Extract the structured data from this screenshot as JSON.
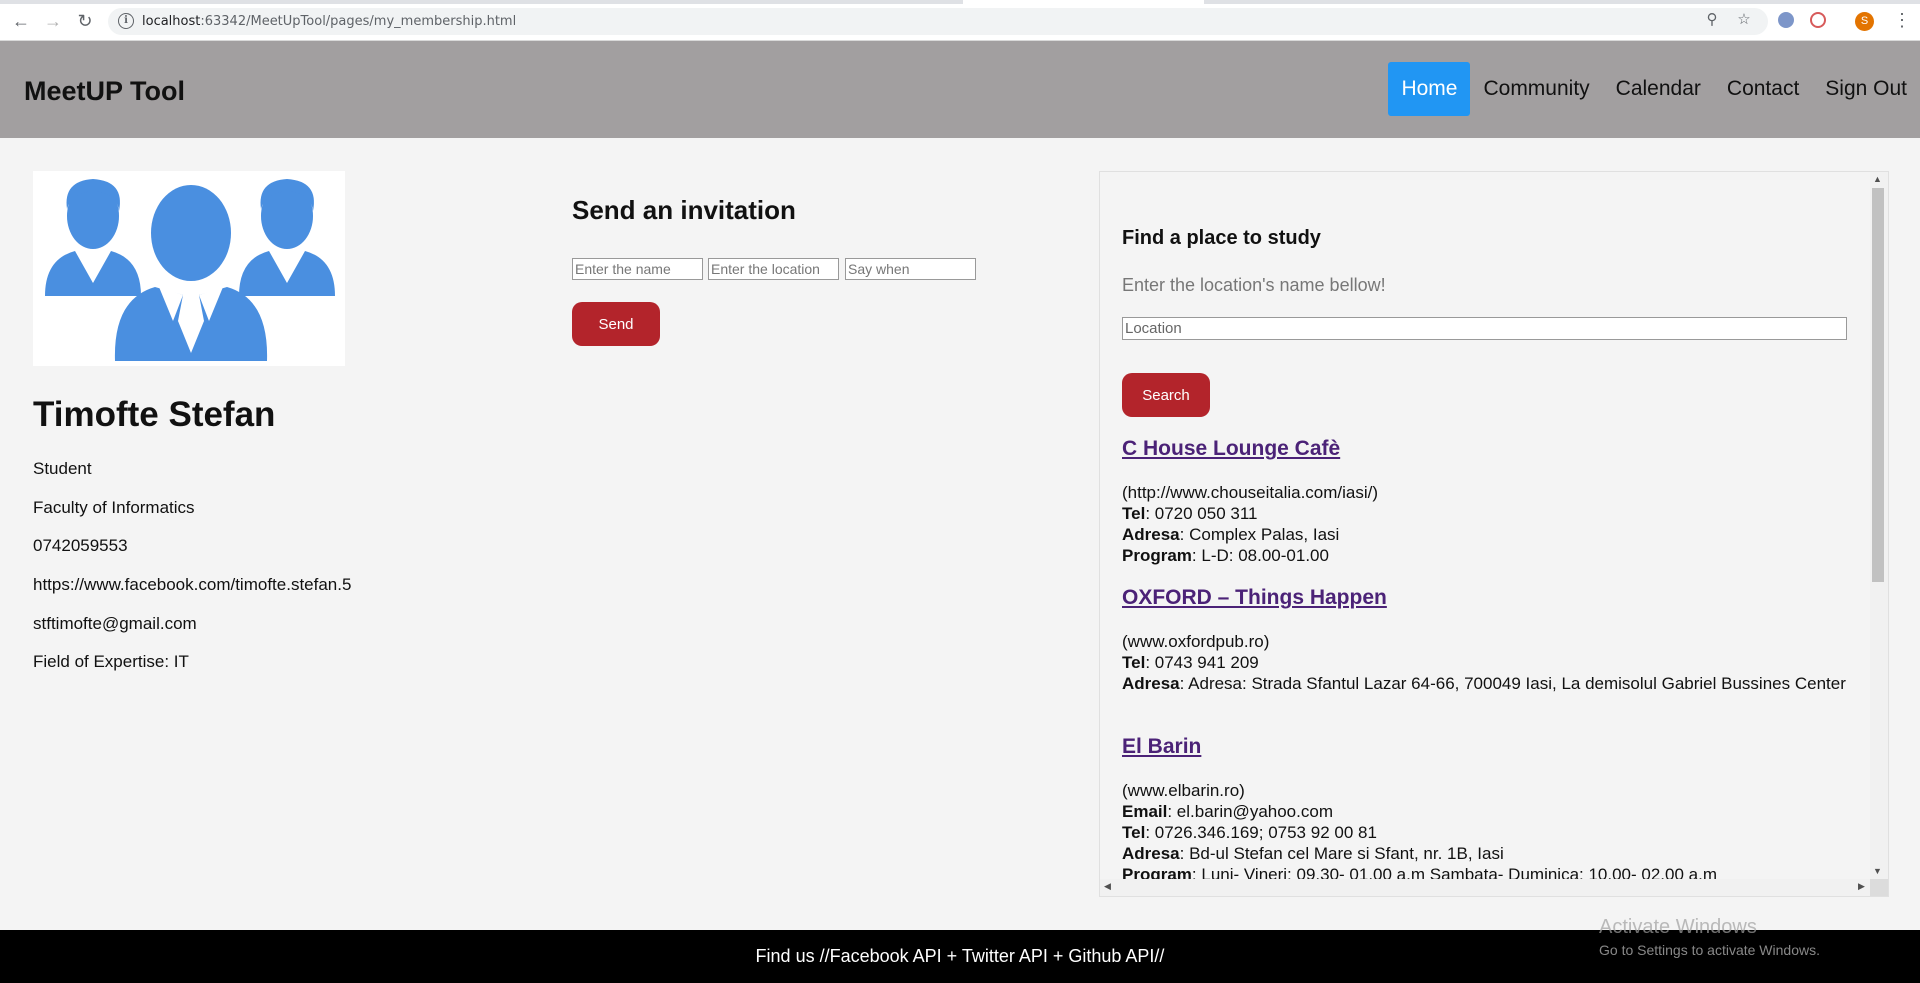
{
  "browser": {
    "url_host": "localhost",
    "url_rest": ":63342/MeetUpTool/pages/my_membership.html",
    "avatar_letter": "S"
  },
  "header": {
    "brand": "MeetUP Tool",
    "nav": [
      {
        "label": "Home",
        "active": true
      },
      {
        "label": "Community"
      },
      {
        "label": "Calendar"
      },
      {
        "label": "Contact"
      },
      {
        "label": "Sign Out"
      }
    ],
    "active_color": "#2196f3"
  },
  "profile": {
    "name": "Timofte Stefan",
    "role": "Student",
    "faculty": "Faculty of Informatics",
    "phone": "0742059553",
    "facebook": "https://www.facebook.com/timofte.stefan.5",
    "email": "stftimofte@gmail.com",
    "expertise": "Field of Expertise: IT",
    "image_icon": "group-people-icon"
  },
  "invitation": {
    "title": "Send an invitation",
    "name_placeholder": "Enter the name",
    "location_placeholder": "Enter the location",
    "when_placeholder": "Say when",
    "send_label": "Send",
    "button_color": "#b3242b"
  },
  "study": {
    "title": "Find a place to study",
    "subtitle": "Enter the location's name bellow!",
    "location_placeholder": "Location",
    "search_label": "Search",
    "places": [
      {
        "name": "C House Lounge Cafè",
        "site": "(http://www.chouseitalia.com/iasi/)",
        "tel_label": "Tel",
        "tel": ": 0720 050 311",
        "adresa_label": "Adresa",
        "adresa": ": Complex Palas, Iasi",
        "program_label": "Program",
        "program": ": L-D: 08.00-01.00"
      },
      {
        "name": "OXFORD – Things Happen",
        "site": "(www.oxfordpub.ro)",
        "tel_label": "Tel",
        "tel": ": 0743 941 209",
        "adresa_label": "Adresa",
        "adresa": ": Adresa: Strada Sfantul Lazar 64-66, 700049 Iasi, La demisolul Gabriel Bussines Center"
      },
      {
        "name": "El Barin",
        "site": "(www.elbarin.ro)",
        "email_label": "Email",
        "email": ": el.barin@yahoo.com",
        "tel_label": "Tel",
        "tel": ": 0726.346.169; 0753 92 00 81",
        "adresa_label": "Adresa",
        "adresa": ": Bd-ul Stefan cel Mare si Sfant, nr. 1B, Iasi",
        "program_label": "Program",
        "program": ": Luni- Vineri: 09.30- 01.00 a.m Sambata- Duminica: 10.00- 02.00 a.m"
      }
    ]
  },
  "footer": {
    "text": "Find us //Facebook API + Twitter API + Github API//"
  },
  "watermark": {
    "title": "Activate Windows",
    "subtitle": "Go to Settings to activate Windows."
  }
}
